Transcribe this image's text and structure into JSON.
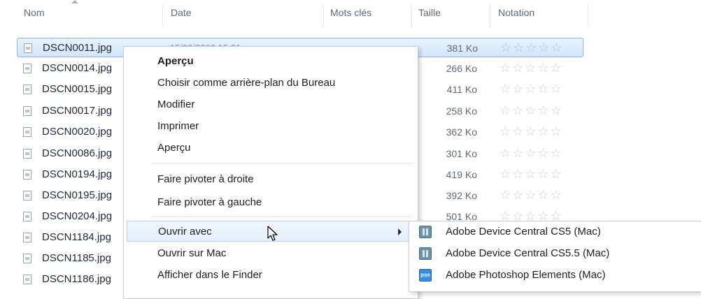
{
  "columns": {
    "name": "Nom",
    "date": "Date",
    "keywords": "Mots clés",
    "size": "Taille",
    "rating": "Notation"
  },
  "files": [
    {
      "name": "DSCN0011.jpg",
      "date": "15/02/2002 15:21",
      "size": "381 Ko",
      "rating": "☆☆☆☆☆",
      "selected": true
    },
    {
      "name": "DSCN0014.jpg",
      "size": "266 Ko",
      "rating": "☆☆☆☆☆"
    },
    {
      "name": "DSCN0015.jpg",
      "size": "411 Ko",
      "rating": "☆☆☆☆☆"
    },
    {
      "name": "DSCN0017.jpg",
      "size": "258 Ko",
      "rating": "☆☆☆☆☆"
    },
    {
      "name": "DSCN0020.jpg",
      "size": "362 Ko",
      "rating": "☆☆☆☆☆"
    },
    {
      "name": "DSCN0086.jpg",
      "size": "301 Ko",
      "rating": "☆☆☆☆☆"
    },
    {
      "name": "DSCN0194.jpg",
      "size": "419 Ko",
      "rating": "☆☆☆☆☆"
    },
    {
      "name": "DSCN0195.jpg",
      "size": "392 Ko",
      "rating": "☆☆☆☆☆"
    },
    {
      "name": "DSCN0204.jpg",
      "size": "501 Ko",
      "rating": "☆☆☆☆☆"
    },
    {
      "name": "DSCN1184.jpg"
    },
    {
      "name": "DSCN1185.jpg"
    },
    {
      "name": "DSCN1186.jpg"
    }
  ],
  "context_menu": {
    "items": [
      {
        "label": "Aperçu",
        "bold": true
      },
      {
        "label": "Choisir comme arrière-plan du Bureau"
      },
      {
        "label": "Modifier"
      },
      {
        "label": "Imprimer"
      },
      {
        "label": "Aperçu"
      },
      {
        "label": "Faire pivoter à droite"
      },
      {
        "label": "Faire pivoter à gauche"
      },
      {
        "label": "Ouvrir avec",
        "has_submenu": true
      },
      {
        "label": "Ouvrir sur Mac"
      },
      {
        "label": "Afficher dans le Finder"
      }
    ]
  },
  "open_with_submenu": {
    "items": [
      {
        "label": "Adobe Device Central CS5 (Mac)",
        "icon": "device-central-icon"
      },
      {
        "label": "Adobe Device Central CS5.5 (Mac)",
        "icon": "device-central-icon"
      },
      {
        "label": "Adobe Photoshop Elements (Mac)",
        "icon": "photoshop-elements-icon",
        "icon_text": "pse"
      }
    ]
  },
  "colors": {
    "selection": "#d3e6fb",
    "selection_border": "#8fb8e8",
    "header_text": "#5a6a7e",
    "menu_hover": "#e2eefc"
  }
}
